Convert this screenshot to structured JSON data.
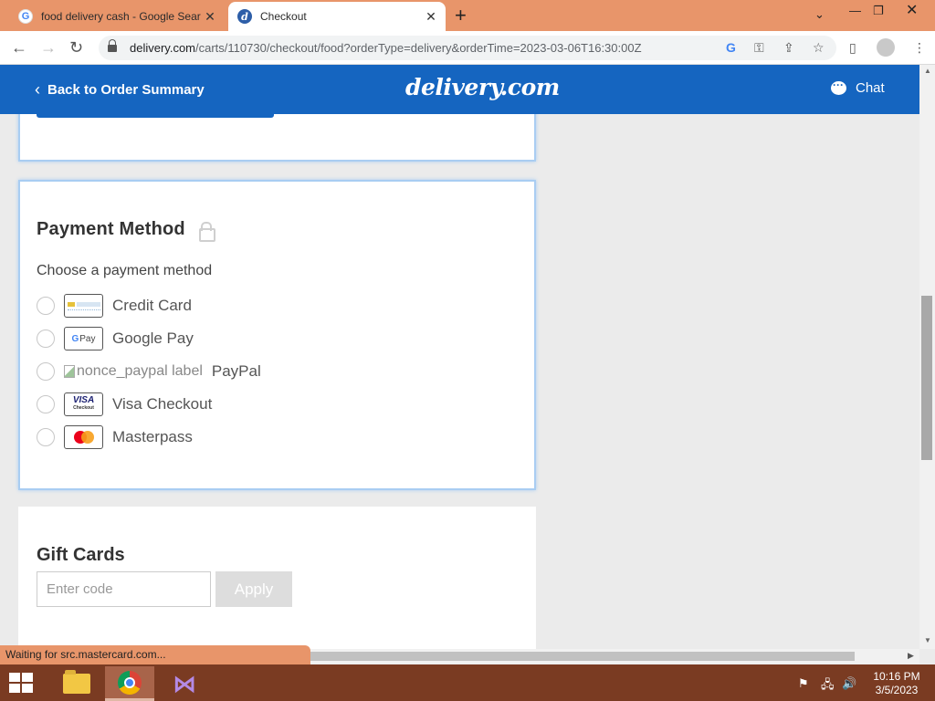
{
  "browser": {
    "tabs": [
      {
        "title": "food delivery cash - Google Sear",
        "favicon": "google-icon",
        "active": false
      },
      {
        "title": "Checkout",
        "favicon": "delivery-icon",
        "active": true
      }
    ],
    "new_tab": "+",
    "url_host": "delivery.com",
    "url_path": "/carts/110730/checkout/food?orderType=delivery&orderTime=2023-03-06T16:30:00Z",
    "status_text": "Waiting for src.mastercard.com...",
    "chrome_color": "#e8956a"
  },
  "header": {
    "back_label": "Back to Order Summary",
    "logo": "delivery.com",
    "chat_label": "Chat",
    "color": "#1565c0"
  },
  "payment": {
    "title": "Payment Method",
    "subtitle": "Choose a payment method",
    "options": [
      {
        "label": "Credit Card",
        "icon": "credit-card-icon"
      },
      {
        "label": "Google Pay",
        "icon": "google-pay-icon",
        "badge": "Pay"
      },
      {
        "label": "PayPal",
        "icon": "broken-image-icon",
        "alt": "nonce_paypal label"
      },
      {
        "label": "Visa Checkout",
        "icon": "visa-icon",
        "badge": "VISA",
        "badge_sub": "Checkout"
      },
      {
        "label": "Masterpass",
        "icon": "mastercard-icon"
      }
    ]
  },
  "gift_cards": {
    "title": "Gift Cards",
    "placeholder": "Enter code",
    "apply_label": "Apply"
  },
  "taskbar": {
    "time": "10:16 PM",
    "date": "3/5/2023",
    "color": "#7a3b22"
  }
}
